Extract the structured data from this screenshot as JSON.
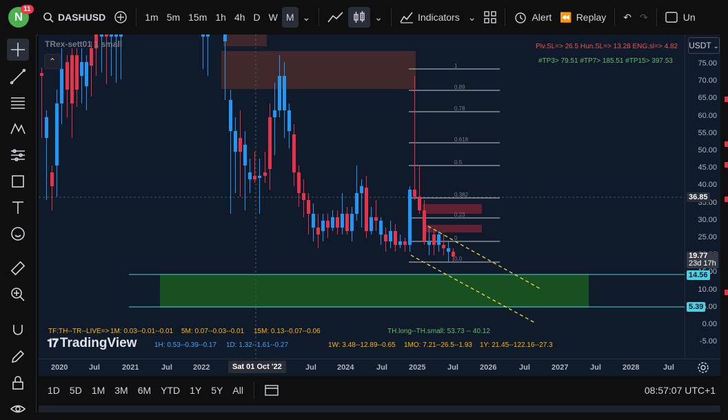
{
  "topbar": {
    "badge_count": "11",
    "avatar_letter": "N",
    "symbol": "DASHUSD",
    "intervals": [
      "1m",
      "5m",
      "15m",
      "1h",
      "4h",
      "D",
      "W",
      "M"
    ],
    "active_interval": "M",
    "indicators_label": "Indicators",
    "alert_label": "Alert",
    "replay_label": "Replay",
    "cut_label": "Un"
  },
  "legend": {
    "title": "TRex-sett01 1 small"
  },
  "chart_info": {
    "row1": "Piv.SL=> 26.5   Hun.SL=> 13.28   ENG.sl=> 4.82",
    "row2": "#TP3> 79.51   #TP7> 185.51   #TP15> 397.53",
    "live": "TF:TH--TR--LIVE=>",
    "m1": "1M: 0.03--0.01--0.01",
    "m5": "5M: 0.07--0.03--0.01",
    "m15": "15M: 0.13--0.07--0.06",
    "h1": "1H: 0.53--0.39--0.17",
    "d1": "1D: 1.32--1.61--0.27",
    "w1": "1W: 3.48--12.89--0.65",
    "mo1": "1MO: 7.21--26.5--1.93",
    "y1": "1Y: 21.45--122.16--27.3",
    "th": "TH.long--TH.small: 53.73 -- 40.12",
    "logo": "TradingView"
  },
  "fib_labels": [
    "1",
    "0.89",
    "0.78",
    "0.618",
    "0.5",
    "0.382",
    "0.23",
    "0",
    "0.0"
  ],
  "price_axis": {
    "currency": "USDT",
    "ticks": [
      "75.00",
      "70.00",
      "65.00",
      "60.00",
      "55.00",
      "50.00",
      "45.00",
      "40.00",
      "35.00",
      "30.00",
      "25.00",
      "20.00",
      "15.00",
      "10.00",
      "5.00",
      "0.00",
      "-5.00"
    ],
    "crosshair_price": "36.85",
    "last_price": "19.77",
    "countdown": "23d 17h",
    "level_top": "14.56",
    "level_bottom": "5.39"
  },
  "time_axis": {
    "ticks": [
      "2020",
      "Jul",
      "2021",
      "Jul",
      "2022",
      "Jul",
      "2024",
      "Jul",
      "2025",
      "Jul",
      "2026",
      "Jul",
      "2027",
      "Jul",
      "2028",
      "Jul"
    ],
    "crosshair_date": "Sat 01 Oct '22"
  },
  "bottom": {
    "ranges": [
      "1D",
      "5D",
      "1M",
      "3M",
      "6M",
      "YTD",
      "1Y",
      "5Y",
      "All"
    ],
    "clock": "08:57:07 UTC+1"
  },
  "colors": {
    "up": "#2196f3",
    "down": "#e5334b",
    "zone_green": "#1b5e20",
    "cyan": "#4dd0e1",
    "bg": "#0f1a2b"
  }
}
